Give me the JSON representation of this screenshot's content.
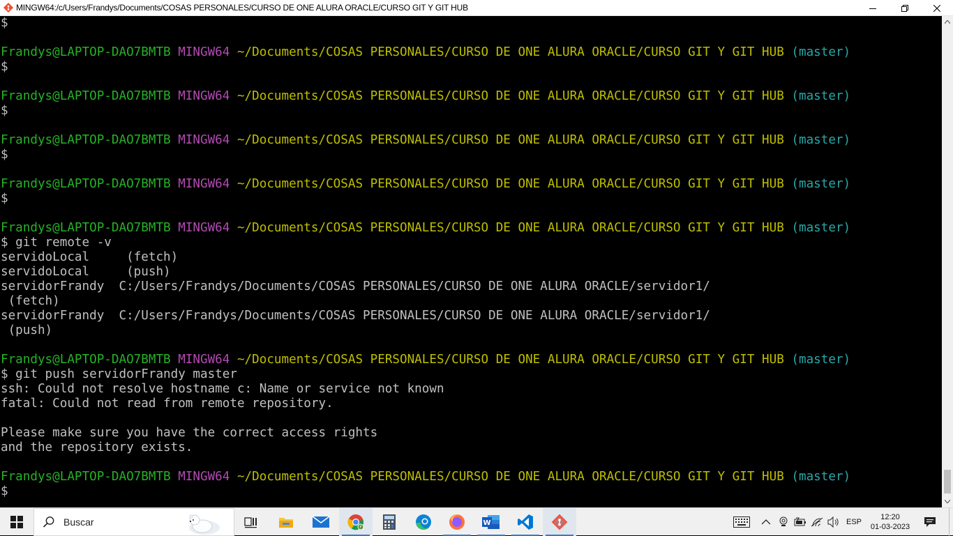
{
  "window": {
    "title": "MINGW64:/c/Users/Frandys/Documents/COSAS PERSONALES/CURSO DE ONE ALURA ORACLE/CURSO GIT Y GIT HUB"
  },
  "terminal": {
    "lines": [
      [
        {
          "t": "$",
          "c": "white"
        }
      ],
      [],
      [
        {
          "t": "Frandys@LAPTOP-DAO7BMTB",
          "c": "green"
        },
        {
          "t": " ",
          "c": "white"
        },
        {
          "t": "MINGW64",
          "c": "magenta"
        },
        {
          "t": " ",
          "c": "white"
        },
        {
          "t": "~/Documents/COSAS PERSONALES/CURSO DE ONE ALURA ORACLE/CURSO GIT Y GIT HUB",
          "c": "yellow"
        },
        {
          "t": " ",
          "c": "white"
        },
        {
          "t": "(master)",
          "c": "cyan"
        }
      ],
      [
        {
          "t": "$",
          "c": "white"
        }
      ],
      [],
      [
        {
          "t": "Frandys@LAPTOP-DAO7BMTB",
          "c": "green"
        },
        {
          "t": " ",
          "c": "white"
        },
        {
          "t": "MINGW64",
          "c": "magenta"
        },
        {
          "t": " ",
          "c": "white"
        },
        {
          "t": "~/Documents/COSAS PERSONALES/CURSO DE ONE ALURA ORACLE/CURSO GIT Y GIT HUB",
          "c": "yellow"
        },
        {
          "t": " ",
          "c": "white"
        },
        {
          "t": "(master)",
          "c": "cyan"
        }
      ],
      [
        {
          "t": "$",
          "c": "white"
        }
      ],
      [],
      [
        {
          "t": "Frandys@LAPTOP-DAO7BMTB",
          "c": "green"
        },
        {
          "t": " ",
          "c": "white"
        },
        {
          "t": "MINGW64",
          "c": "magenta"
        },
        {
          "t": " ",
          "c": "white"
        },
        {
          "t": "~/Documents/COSAS PERSONALES/CURSO DE ONE ALURA ORACLE/CURSO GIT Y GIT HUB",
          "c": "yellow"
        },
        {
          "t": " ",
          "c": "white"
        },
        {
          "t": "(master)",
          "c": "cyan"
        }
      ],
      [
        {
          "t": "$",
          "c": "white"
        }
      ],
      [],
      [
        {
          "t": "Frandys@LAPTOP-DAO7BMTB",
          "c": "green"
        },
        {
          "t": " ",
          "c": "white"
        },
        {
          "t": "MINGW64",
          "c": "magenta"
        },
        {
          "t": " ",
          "c": "white"
        },
        {
          "t": "~/Documents/COSAS PERSONALES/CURSO DE ONE ALURA ORACLE/CURSO GIT Y GIT HUB",
          "c": "yellow"
        },
        {
          "t": " ",
          "c": "white"
        },
        {
          "t": "(master)",
          "c": "cyan"
        }
      ],
      [
        {
          "t": "$",
          "c": "white"
        }
      ],
      [],
      [
        {
          "t": "Frandys@LAPTOP-DAO7BMTB",
          "c": "green"
        },
        {
          "t": " ",
          "c": "white"
        },
        {
          "t": "MINGW64",
          "c": "magenta"
        },
        {
          "t": " ",
          "c": "white"
        },
        {
          "t": "~/Documents/COSAS PERSONALES/CURSO DE ONE ALURA ORACLE/CURSO GIT Y GIT HUB",
          "c": "yellow"
        },
        {
          "t": " ",
          "c": "white"
        },
        {
          "t": "(master)",
          "c": "cyan"
        }
      ],
      [
        {
          "t": "$ git remote -v",
          "c": "white"
        }
      ],
      [
        {
          "t": "servidoLocal     (fetch)",
          "c": "white"
        }
      ],
      [
        {
          "t": "servidoLocal     (push)",
          "c": "white"
        }
      ],
      [
        {
          "t": "servidorFrandy  C:/Users/Frandys/Documents/COSAS PERSONALES/CURSO DE ONE ALURA ORACLE/servidor1/",
          "c": "white"
        }
      ],
      [
        {
          "t": " (fetch)",
          "c": "white"
        }
      ],
      [
        {
          "t": "servidorFrandy  C:/Users/Frandys/Documents/COSAS PERSONALES/CURSO DE ONE ALURA ORACLE/servidor1/",
          "c": "white"
        }
      ],
      [
        {
          "t": " (push)",
          "c": "white"
        }
      ],
      [],
      [
        {
          "t": "Frandys@LAPTOP-DAO7BMTB",
          "c": "green"
        },
        {
          "t": " ",
          "c": "white"
        },
        {
          "t": "MINGW64",
          "c": "magenta"
        },
        {
          "t": " ",
          "c": "white"
        },
        {
          "t": "~/Documents/COSAS PERSONALES/CURSO DE ONE ALURA ORACLE/CURSO GIT Y GIT HUB",
          "c": "yellow"
        },
        {
          "t": " ",
          "c": "white"
        },
        {
          "t": "(master)",
          "c": "cyan"
        }
      ],
      [
        {
          "t": "$ git push servidorFrandy master",
          "c": "white"
        }
      ],
      [
        {
          "t": "ssh: Could not resolve hostname c: Name or service not known",
          "c": "white"
        }
      ],
      [
        {
          "t": "fatal: Could not read from remote repository.",
          "c": "white"
        }
      ],
      [],
      [
        {
          "t": "Please make sure you have the correct access rights",
          "c": "white"
        }
      ],
      [
        {
          "t": "and the repository exists.",
          "c": "white"
        }
      ],
      [],
      [
        {
          "t": "Frandys@LAPTOP-DAO7BMTB",
          "c": "green"
        },
        {
          "t": " ",
          "c": "white"
        },
        {
          "t": "MINGW64",
          "c": "magenta"
        },
        {
          "t": " ",
          "c": "white"
        },
        {
          "t": "~/Documents/COSAS PERSONALES/CURSO DE ONE ALURA ORACLE/CURSO GIT Y GIT HUB",
          "c": "yellow"
        },
        {
          "t": " ",
          "c": "white"
        },
        {
          "t": "(master)",
          "c": "cyan"
        }
      ],
      [
        {
          "t": "$",
          "c": "white"
        }
      ]
    ]
  },
  "taskbar": {
    "search_placeholder": "Buscar",
    "apps": [
      "task-view-icon",
      "file-explorer-icon",
      "mail-icon",
      "chrome-icon",
      "calculator-icon",
      "edge-icon",
      "firefox-icon",
      "word-icon",
      "vscode-icon",
      "git-icon"
    ],
    "tray": {
      "language": "ESP",
      "time": "12:20",
      "date": "01-03-2023"
    }
  },
  "colors": {
    "green": "#26b226",
    "magenta": "#b24ab2",
    "yellow": "#bfbf00",
    "cyan": "#29a8a8",
    "white": "#c0c0c0",
    "accent": "#3b78c4"
  }
}
